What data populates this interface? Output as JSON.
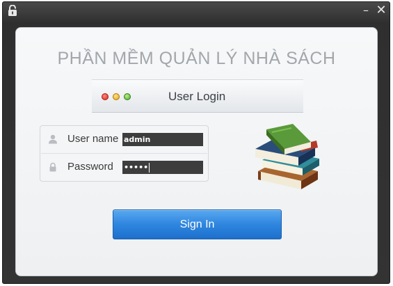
{
  "window": {
    "minimize_glyph": "–",
    "close_glyph": "✕",
    "app_icon": "lock-icon"
  },
  "app": {
    "title": "PHẦN MỀM QUẢN LÝ NHÀ SÁCH"
  },
  "login_header": {
    "title": "User Login",
    "traffic_lights": [
      "red",
      "yellow",
      "green"
    ]
  },
  "form": {
    "username": {
      "label": "User name",
      "value": "admin",
      "icon": "user-icon"
    },
    "password": {
      "label": "Password",
      "masked_value": "•••••",
      "icon": "lock-icon"
    }
  },
  "illustration": "books-icon",
  "signin_button": {
    "label": "Sign In"
  },
  "colors": {
    "accent": "#2f86df",
    "title_gray": "#a3a7ab",
    "frame": "#333333"
  }
}
